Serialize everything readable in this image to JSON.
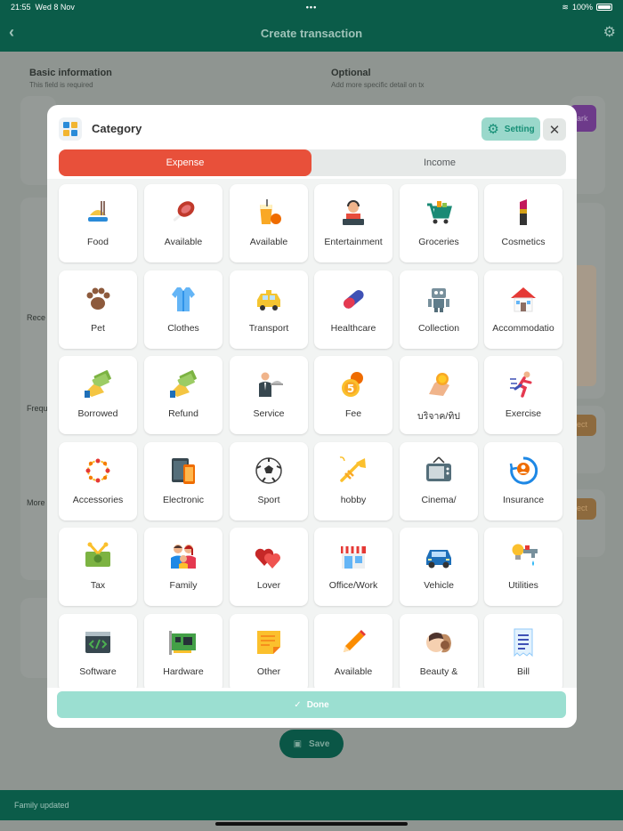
{
  "status": {
    "time": "21:55",
    "date": "Wed 8 Nov",
    "battery": "100%"
  },
  "header": {
    "title": "Create transaction"
  },
  "background": {
    "basic_title": "Basic information",
    "basic_sub": "This field is required",
    "optional_title": "Optional",
    "optional_sub": "Add more specific detail on tx",
    "recent": "Rece",
    "frequent": "Frequ",
    "more": "More",
    "mark": "ark",
    "select1": "ect",
    "select2": "ect",
    "save_label": "Save",
    "toast": "Family updated"
  },
  "modal": {
    "title": "Category",
    "setting_label": "Setting",
    "tabs": {
      "expense": "Expense",
      "income": "Income"
    },
    "done_label": "Done",
    "categories": [
      {
        "label": "Food",
        "icon": "food-icon"
      },
      {
        "label": "Available",
        "icon": "meat-icon"
      },
      {
        "label": "Available",
        "icon": "juice-icon"
      },
      {
        "label": "Entertainment",
        "icon": "dj-icon"
      },
      {
        "label": "Groceries",
        "icon": "cart-icon"
      },
      {
        "label": "Cosmetics",
        "icon": "lipstick-icon"
      },
      {
        "label": "Pet",
        "icon": "paw-icon"
      },
      {
        "label": "Clothes",
        "icon": "shirt-icon"
      },
      {
        "label": "Transport",
        "icon": "taxi-icon"
      },
      {
        "label": "Healthcare",
        "icon": "pill-icon"
      },
      {
        "label": "Collection",
        "icon": "robot-icon"
      },
      {
        "label": "Accommodatio",
        "icon": "house-icon"
      },
      {
        "label": "Borrowed",
        "icon": "money-hand-icon"
      },
      {
        "label": "Refund",
        "icon": "money-hand-icon"
      },
      {
        "label": "Service",
        "icon": "waiter-icon"
      },
      {
        "label": "Fee",
        "icon": "coins-icon"
      },
      {
        "label": "บริจาค/ทิป",
        "icon": "tip-icon"
      },
      {
        "label": "Exercise",
        "icon": "runner-icon"
      },
      {
        "label": "Accessories",
        "icon": "necklace-icon"
      },
      {
        "label": "Electronic",
        "icon": "devices-icon"
      },
      {
        "label": "Sport",
        "icon": "soccer-icon"
      },
      {
        "label": "hobby",
        "icon": "trumpet-icon"
      },
      {
        "label": "Cinema/",
        "icon": "tv-icon"
      },
      {
        "label": "Insurance",
        "icon": "insurance-icon"
      },
      {
        "label": "Tax",
        "icon": "tax-icon"
      },
      {
        "label": "Family",
        "icon": "family-icon"
      },
      {
        "label": "Lover",
        "icon": "hearts-icon"
      },
      {
        "label": "Office/Work",
        "icon": "shop-icon"
      },
      {
        "label": "Vehicle",
        "icon": "car-icon"
      },
      {
        "label": "Utilities",
        "icon": "utilities-icon"
      },
      {
        "label": "Software",
        "icon": "code-icon"
      },
      {
        "label": "Hardware",
        "icon": "circuit-board-icon"
      },
      {
        "label": "Other",
        "icon": "note-icon"
      },
      {
        "label": "Available",
        "icon": "pencil-icon"
      },
      {
        "label": "Beauty &",
        "icon": "beauty-icon"
      },
      {
        "label": "Bill",
        "icon": "bill-icon"
      }
    ]
  },
  "colors": {
    "primary": "#0b5c49",
    "expense": "#e8503a",
    "done": "#9bdfd1",
    "setting_bg": "#9ad8cb"
  }
}
